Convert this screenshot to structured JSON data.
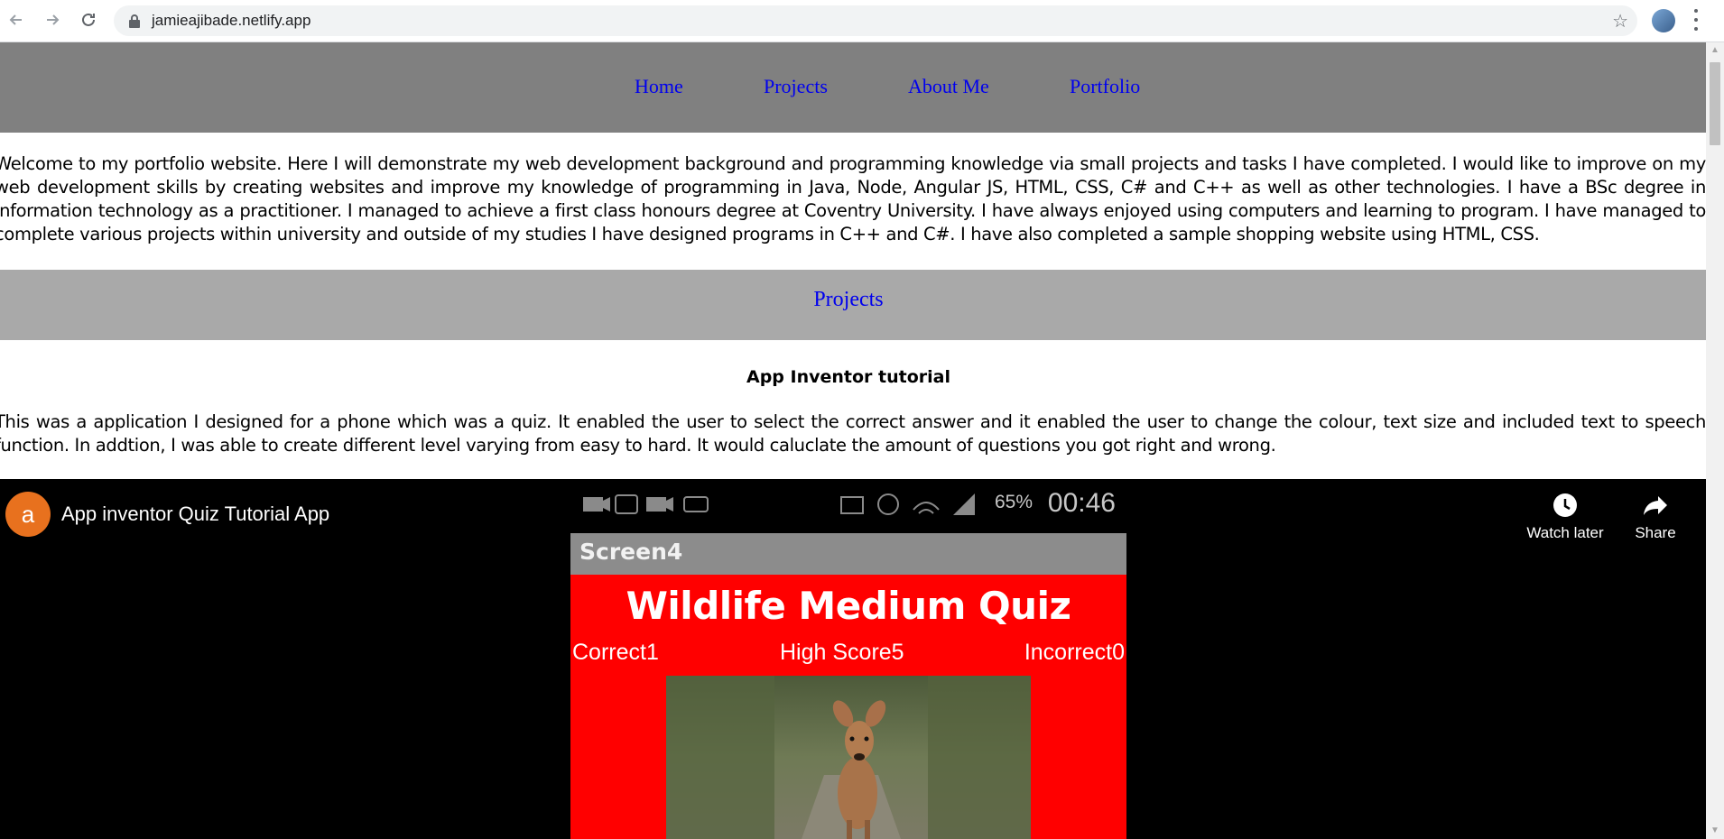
{
  "browser": {
    "url": "jamieajibade.netlify.app"
  },
  "nav": {
    "items": [
      {
        "label": "Home"
      },
      {
        "label": "Projects"
      },
      {
        "label": "About Me"
      },
      {
        "label": "Portfolio"
      }
    ]
  },
  "intro": {
    "text": "Welcome to my portfolio website. Here I will demonstrate my web development background and programming knowledge via small projects and tasks I have completed. I would like to improve on my web development skills by creating websites and improve my knowledge of programming in Java, Node, Angular JS, HTML, CSS, C# and C++ as well as other technologies. I have a BSc degree in information technology as a practitioner. I managed to achieve a first class honours degree at Coventry University. I have always enjoyed using computers and learning to program. I have managed to complete various projects within university and outside of my studies I have designed programs in C++ and C#. I have also completed a sample shopping website using HTML, CSS."
  },
  "projects_section": {
    "title": "Projects",
    "items": [
      {
        "title": "App Inventor tutorial",
        "description": "This was a application I designed for a phone which was a quiz. It enabled the user to select the correct answer and it enabled the user to change the colour, text size and included text to speech function. In addtion, I was able to create different level varying from easy to hard. It would caluclate the amount of questions you got right and wrong."
      }
    ]
  },
  "video": {
    "channel_initial": "a",
    "title": "App inventor Quiz Tutorial App",
    "watch_later_label": "Watch later",
    "share_label": "Share",
    "frame": {
      "status_battery": "65%",
      "status_time": "00:46",
      "screen_label": "Screen4",
      "quiz_title": "Wildlife Medium Quiz",
      "correct": "Correct1",
      "high_score": "High Score5",
      "incorrect": "Incorrect0"
    }
  },
  "colors": {
    "nav_bg": "#808080",
    "section_bg": "#a9a9a9",
    "link": "#0000ee",
    "quiz_bg": "#ff0000",
    "channel_avatar": "#e8711e"
  }
}
